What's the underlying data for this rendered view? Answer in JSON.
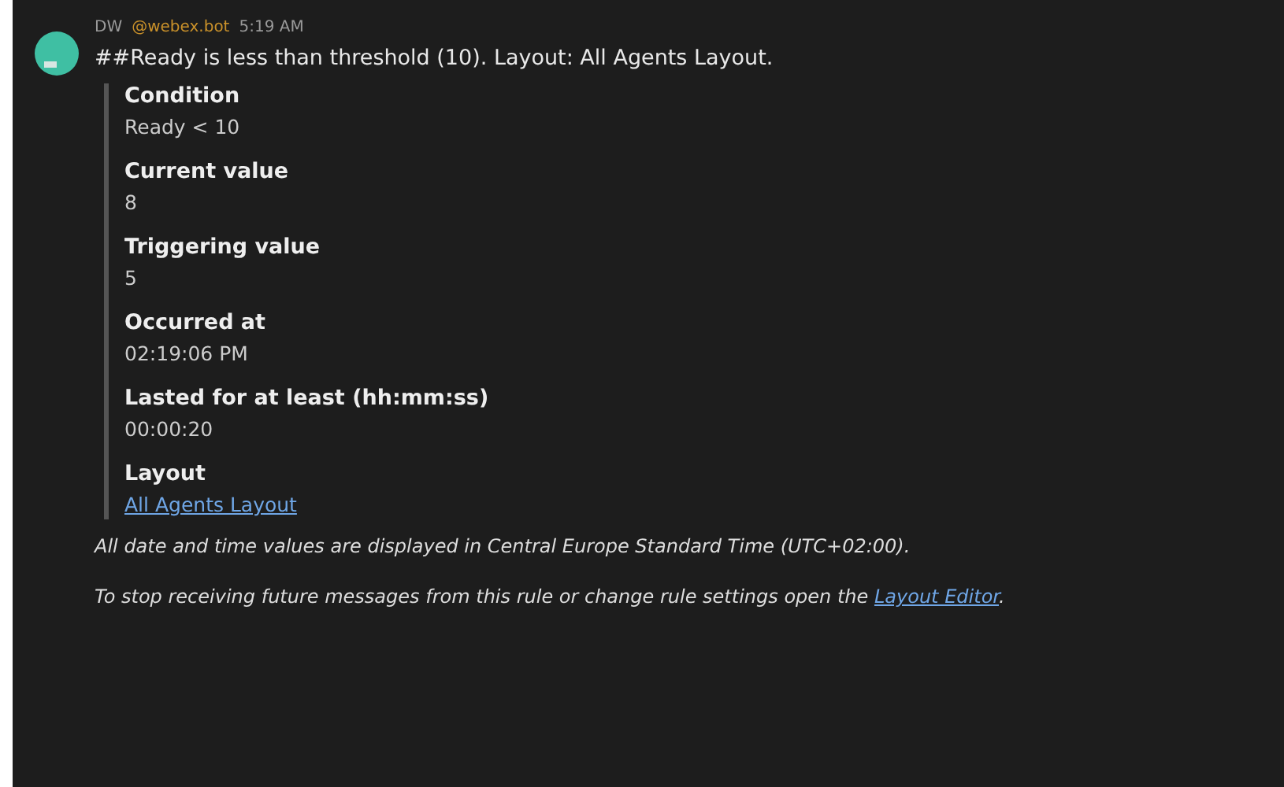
{
  "message": {
    "sender": "DW",
    "bot_tag": "@webex.bot",
    "time": "5:19 AM",
    "text": "##Ready is less than threshold (10). Layout: All Agents Layout.",
    "fields": [
      {
        "label": "Condition",
        "value": "Ready < 10",
        "kind": "text"
      },
      {
        "label": "Current value",
        "value": "8",
        "kind": "text"
      },
      {
        "label": "Triggering value",
        "value": "5",
        "kind": "text"
      },
      {
        "label": "Occurred at",
        "value": "02:19:06 PM",
        "kind": "text"
      },
      {
        "label": "Lasted for at least (hh:mm:ss)",
        "value": "00:00:20",
        "kind": "text"
      },
      {
        "label": "Layout",
        "value": "All Agents Layout",
        "kind": "link"
      }
    ],
    "timezone_note": "All date and time values are displayed in Central Europe Standard Time (UTC+02:00).",
    "footer_text": "To stop receiving future messages from this rule or change rule settings open the",
    "footer_link": "Layout Editor",
    "footer_end": "."
  }
}
